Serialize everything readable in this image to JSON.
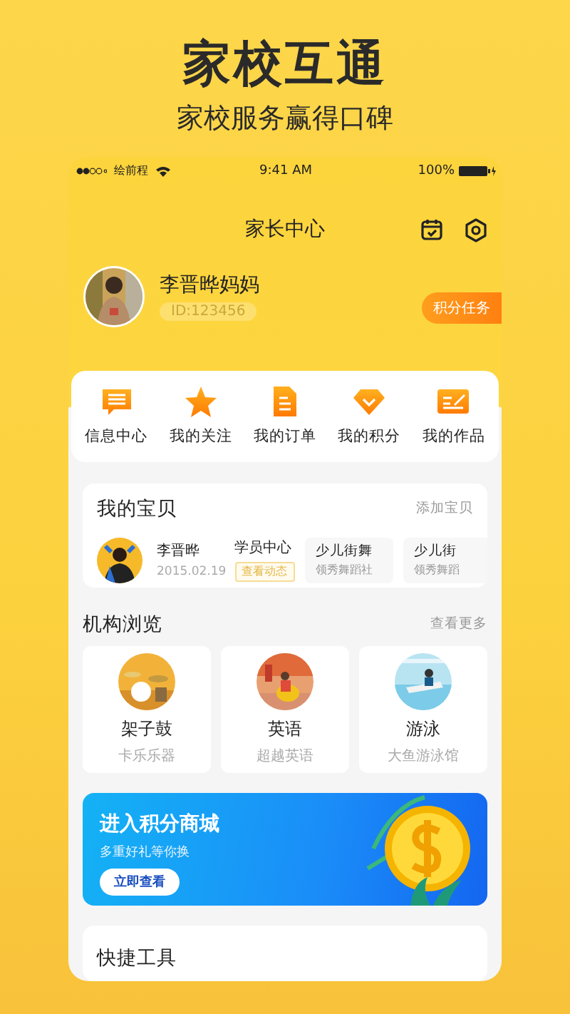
{
  "headline": "家校互通",
  "subheadline": "家校服务赢得口碑",
  "status_bar": {
    "carrier": "绘前程",
    "time": "9:41 AM",
    "battery": "100%"
  },
  "header": {
    "title": "家长中心"
  },
  "profile": {
    "name": "李晋晔妈妈",
    "id": "ID:123456",
    "task_button": "积分任务"
  },
  "menu": [
    {
      "label": "信息中心",
      "kind": "message"
    },
    {
      "label": "我的关注",
      "kind": "star"
    },
    {
      "label": "我的订单",
      "kind": "document"
    },
    {
      "label": "我的积分",
      "kind": "diamond"
    },
    {
      "label": "我的作品",
      "kind": "edit"
    }
  ],
  "my_kids": {
    "title": "我的宝贝",
    "action": "添加宝贝",
    "child": {
      "name": "李晋晔",
      "birthdate": "2015.02.19"
    },
    "center": {
      "label": "学员中心",
      "button": "查看动态"
    },
    "classes": [
      {
        "course": "少儿街舞",
        "school": "领秀舞蹈社"
      },
      {
        "course": "少儿街",
        "school": "领秀舞蹈"
      }
    ]
  },
  "institutions": {
    "title": "机构浏览",
    "more": "查看更多",
    "items": [
      {
        "name": "架子鼓",
        "org": "卡乐乐器"
      },
      {
        "name": "英语",
        "org": "超越英语"
      },
      {
        "name": "游泳",
        "org": "大鱼游泳馆"
      }
    ]
  },
  "banner": {
    "title": "进入积分商城",
    "subtitle": "多重好礼等你换",
    "button": "立即查看"
  },
  "tools": {
    "title": "快捷工具"
  }
}
